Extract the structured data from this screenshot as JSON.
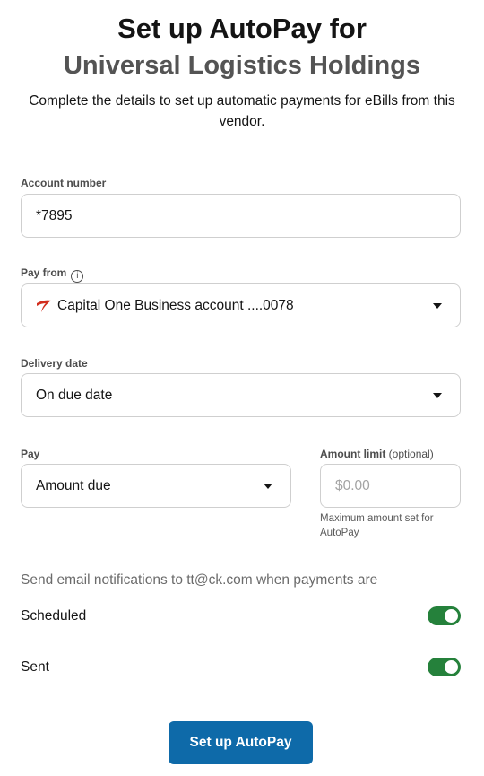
{
  "header": {
    "title_line1": "Set up AutoPay for",
    "title_line2": "Universal Logistics Holdings",
    "subtitle": "Complete the details to set up automatic payments for eBills from this vendor."
  },
  "account_number": {
    "label": "Account number",
    "value": "*7895"
  },
  "pay_from": {
    "label": "Pay from",
    "info_icon": "info-icon",
    "bank_icon": "capital-one-logo-icon",
    "value": "Capital One Business account ....0078"
  },
  "delivery_date": {
    "label": "Delivery date",
    "value": "On due date"
  },
  "pay": {
    "label": "Pay",
    "value": "Amount due"
  },
  "amount_limit": {
    "label": "Amount limit",
    "label_optional": "(optional)",
    "placeholder": "$0.00",
    "helper": "Maximum amount set for AutoPay"
  },
  "notifications": {
    "heading": "Send email notifications to tt@ck.com when payments are",
    "items": [
      {
        "label": "Scheduled",
        "enabled": true
      },
      {
        "label": "Sent",
        "enabled": true
      }
    ],
    "toggle_color": "#25813b"
  },
  "cta": {
    "label": "Set up AutoPay",
    "color": "#0e6aa9"
  }
}
